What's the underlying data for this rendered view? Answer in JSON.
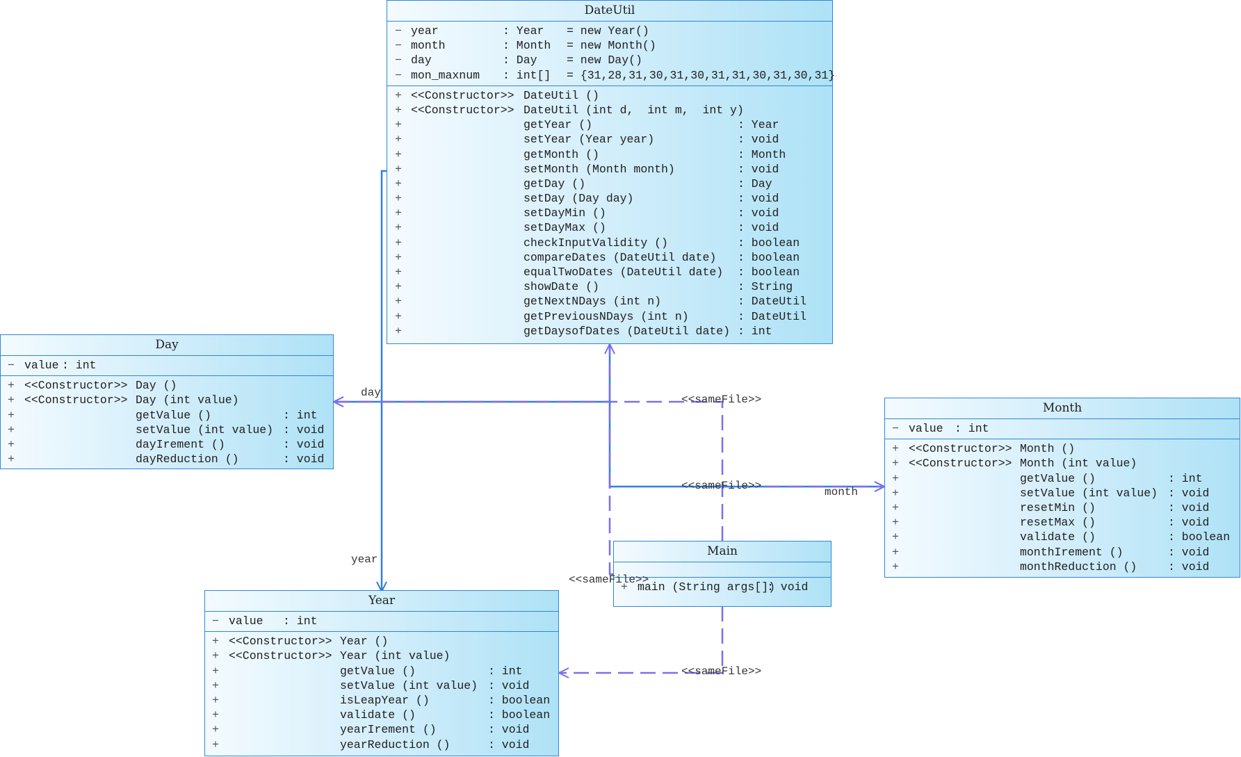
{
  "classes": {
    "dateutil": {
      "name": "DateUtil",
      "attributes": [
        {
          "vis": "−",
          "name": "year",
          "type": ": Year",
          "init": "= new Year()"
        },
        {
          "vis": "−",
          "name": "month",
          "type": ": Month",
          "init": "= new Month()"
        },
        {
          "vis": "−",
          "name": "day",
          "type": ": Day",
          "init": "= new Day()"
        },
        {
          "vis": "−",
          "name": "mon_maxnum",
          "type": ": int[]",
          "init": "= {31,28,31,30,31,30,31,31,30,31,30,31}"
        }
      ],
      "operations": [
        {
          "vis": "+",
          "stereo": "<<Constructor>>",
          "sig": "DateUtil ()",
          "ret": ""
        },
        {
          "vis": "+",
          "stereo": "<<Constructor>>",
          "sig": "DateUtil (int d,  int m,  int y)",
          "ret": ""
        },
        {
          "vis": "+",
          "stereo": "",
          "sig": "getYear ()",
          "ret": ": Year"
        },
        {
          "vis": "+",
          "stereo": "",
          "sig": "setYear (Year year)",
          "ret": ": void"
        },
        {
          "vis": "+",
          "stereo": "",
          "sig": "getMonth ()",
          "ret": ": Month"
        },
        {
          "vis": "+",
          "stereo": "",
          "sig": "setMonth (Month month)",
          "ret": ": void"
        },
        {
          "vis": "+",
          "stereo": "",
          "sig": "getDay ()",
          "ret": ": Day"
        },
        {
          "vis": "+",
          "stereo": "",
          "sig": "setDay (Day day)",
          "ret": ": void"
        },
        {
          "vis": "+",
          "stereo": "",
          "sig": "setDayMin ()",
          "ret": ": void"
        },
        {
          "vis": "+",
          "stereo": "",
          "sig": "setDayMax ()",
          "ret": ": void"
        },
        {
          "vis": "+",
          "stereo": "",
          "sig": "checkInputValidity ()",
          "ret": ": boolean"
        },
        {
          "vis": "+",
          "stereo": "",
          "sig": "compareDates (DateUtil date)",
          "ret": ": boolean"
        },
        {
          "vis": "+",
          "stereo": "",
          "sig": "equalTwoDates (DateUtil date)",
          "ret": ": boolean"
        },
        {
          "vis": "+",
          "stereo": "",
          "sig": "showDate ()",
          "ret": ": String"
        },
        {
          "vis": "+",
          "stereo": "",
          "sig": "getNextNDays (int n)",
          "ret": ": DateUtil"
        },
        {
          "vis": "+",
          "stereo": "",
          "sig": "getPreviousNDays (int n)",
          "ret": ": DateUtil"
        },
        {
          "vis": "+",
          "stereo": "",
          "sig": "getDaysofDates (DateUtil date)",
          "ret": ": int"
        }
      ]
    },
    "day": {
      "name": "Day",
      "attributes": [
        {
          "vis": "−",
          "name": "value",
          "type": ": int",
          "init": ""
        }
      ],
      "operations": [
        {
          "vis": "+",
          "stereo": "<<Constructor>>",
          "sig": "Day ()",
          "ret": ""
        },
        {
          "vis": "+",
          "stereo": "<<Constructor>>",
          "sig": "Day (int value)",
          "ret": ""
        },
        {
          "vis": "+",
          "stereo": "",
          "sig": "getValue ()",
          "ret": ": int"
        },
        {
          "vis": "+",
          "stereo": "",
          "sig": "setValue (int value)",
          "ret": ": void"
        },
        {
          "vis": "+",
          "stereo": "",
          "sig": "dayIrement ()",
          "ret": ": void"
        },
        {
          "vis": "+",
          "stereo": "",
          "sig": "dayReduction ()",
          "ret": ": void"
        }
      ]
    },
    "month": {
      "name": "Month",
      "attributes": [
        {
          "vis": "−",
          "name": "value",
          "type": ": int",
          "init": ""
        }
      ],
      "operations": [
        {
          "vis": "+",
          "stereo": "<<Constructor>>",
          "sig": "Month ()",
          "ret": ""
        },
        {
          "vis": "+",
          "stereo": "<<Constructor>>",
          "sig": "Month (int value)",
          "ret": ""
        },
        {
          "vis": "+",
          "stereo": "",
          "sig": "getValue ()",
          "ret": ": int"
        },
        {
          "vis": "+",
          "stereo": "",
          "sig": "setValue (int value)",
          "ret": ": void"
        },
        {
          "vis": "+",
          "stereo": "",
          "sig": "resetMin ()",
          "ret": ": void"
        },
        {
          "vis": "+",
          "stereo": "",
          "sig": "resetMax ()",
          "ret": ": void"
        },
        {
          "vis": "+",
          "stereo": "",
          "sig": "validate ()",
          "ret": ": boolean"
        },
        {
          "vis": "+",
          "stereo": "",
          "sig": "monthIrement ()",
          "ret": ": void"
        },
        {
          "vis": "+",
          "stereo": "",
          "sig": "monthReduction ()",
          "ret": ": void"
        }
      ]
    },
    "main": {
      "name": "Main",
      "attributes": [],
      "operations": [
        {
          "vis": "+",
          "stereo": "",
          "sig": "main (String args[])",
          "ret": ": void"
        }
      ]
    },
    "year": {
      "name": "Year",
      "attributes": [
        {
          "vis": "−",
          "name": "value",
          "type": ": int",
          "init": ""
        }
      ],
      "operations": [
        {
          "vis": "+",
          "stereo": "<<Constructor>>",
          "sig": "Year ()",
          "ret": ""
        },
        {
          "vis": "+",
          "stereo": "<<Constructor>>",
          "sig": "Year (int value)",
          "ret": ""
        },
        {
          "vis": "+",
          "stereo": "",
          "sig": "getValue ()",
          "ret": ": int"
        },
        {
          "vis": "+",
          "stereo": "",
          "sig": "setValue (int value)",
          "ret": ": void"
        },
        {
          "vis": "+",
          "stereo": "",
          "sig": "isLeapYear ()",
          "ret": ": boolean"
        },
        {
          "vis": "+",
          "stereo": "",
          "sig": "validate ()",
          "ret": ": boolean"
        },
        {
          "vis": "+",
          "stereo": "",
          "sig": "yearIrement ()",
          "ret": ": void"
        },
        {
          "vis": "+",
          "stereo": "",
          "sig": "yearReduction ()",
          "ret": ": void"
        }
      ]
    }
  },
  "labels": {
    "day_role": "day",
    "month_role": "month",
    "year_role": "year",
    "samefile_day": "<<sameFile>>",
    "samefile_month": "<<sameFile>>",
    "samefile_dateutil": "<<sameFile>>",
    "samefile_year": "<<sameFile>>"
  },
  "colors": {
    "border": "#2f86d6",
    "association": "#2f7ee0",
    "dependency": "#7a6ff0"
  }
}
